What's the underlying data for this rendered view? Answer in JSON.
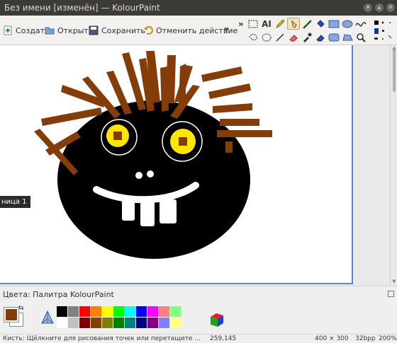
{
  "window": {
    "title": "Без имени [изменён] — KolourPaint",
    "minimize_glyph": "▾",
    "maximize_glyph": "▴",
    "close_glyph": "✕"
  },
  "toolbar": {
    "new_label": "Создать",
    "open_label": "Открыть",
    "save_label": "Сохранить",
    "undo_label": "Отменить действие",
    "more_glyph": "»"
  },
  "tools": {
    "text_tool_label": "AI",
    "active": "pen-tool"
  },
  "canvas": {
    "tooltip": "ница 1"
  },
  "palette": {
    "title": "Цвета: Палитра KolourPaint",
    "foreground_color": "#843c09",
    "background_color": "#ffffff",
    "swatches_row1": [
      "#000000",
      "#808080",
      "#ff0000",
      "#ff8000",
      "#ffff00",
      "#00ff00",
      "#00ffff",
      "#0000ff",
      "#ff00ff",
      "#ff8080",
      "#80ff80"
    ],
    "swatches_row2": [
      "#ffffff",
      "#c0c0c0",
      "#800000",
      "#804000",
      "#808000",
      "#008000",
      "#008080",
      "#000080",
      "#800080",
      "#8080ff",
      "#ffff80"
    ]
  },
  "status": {
    "hint": "Кисть: Щёлкните для рисования точек или перетащите ...",
    "position": "259,145",
    "image_size": "400 × 300",
    "depth": "32bpp",
    "zoom": "200%"
  }
}
